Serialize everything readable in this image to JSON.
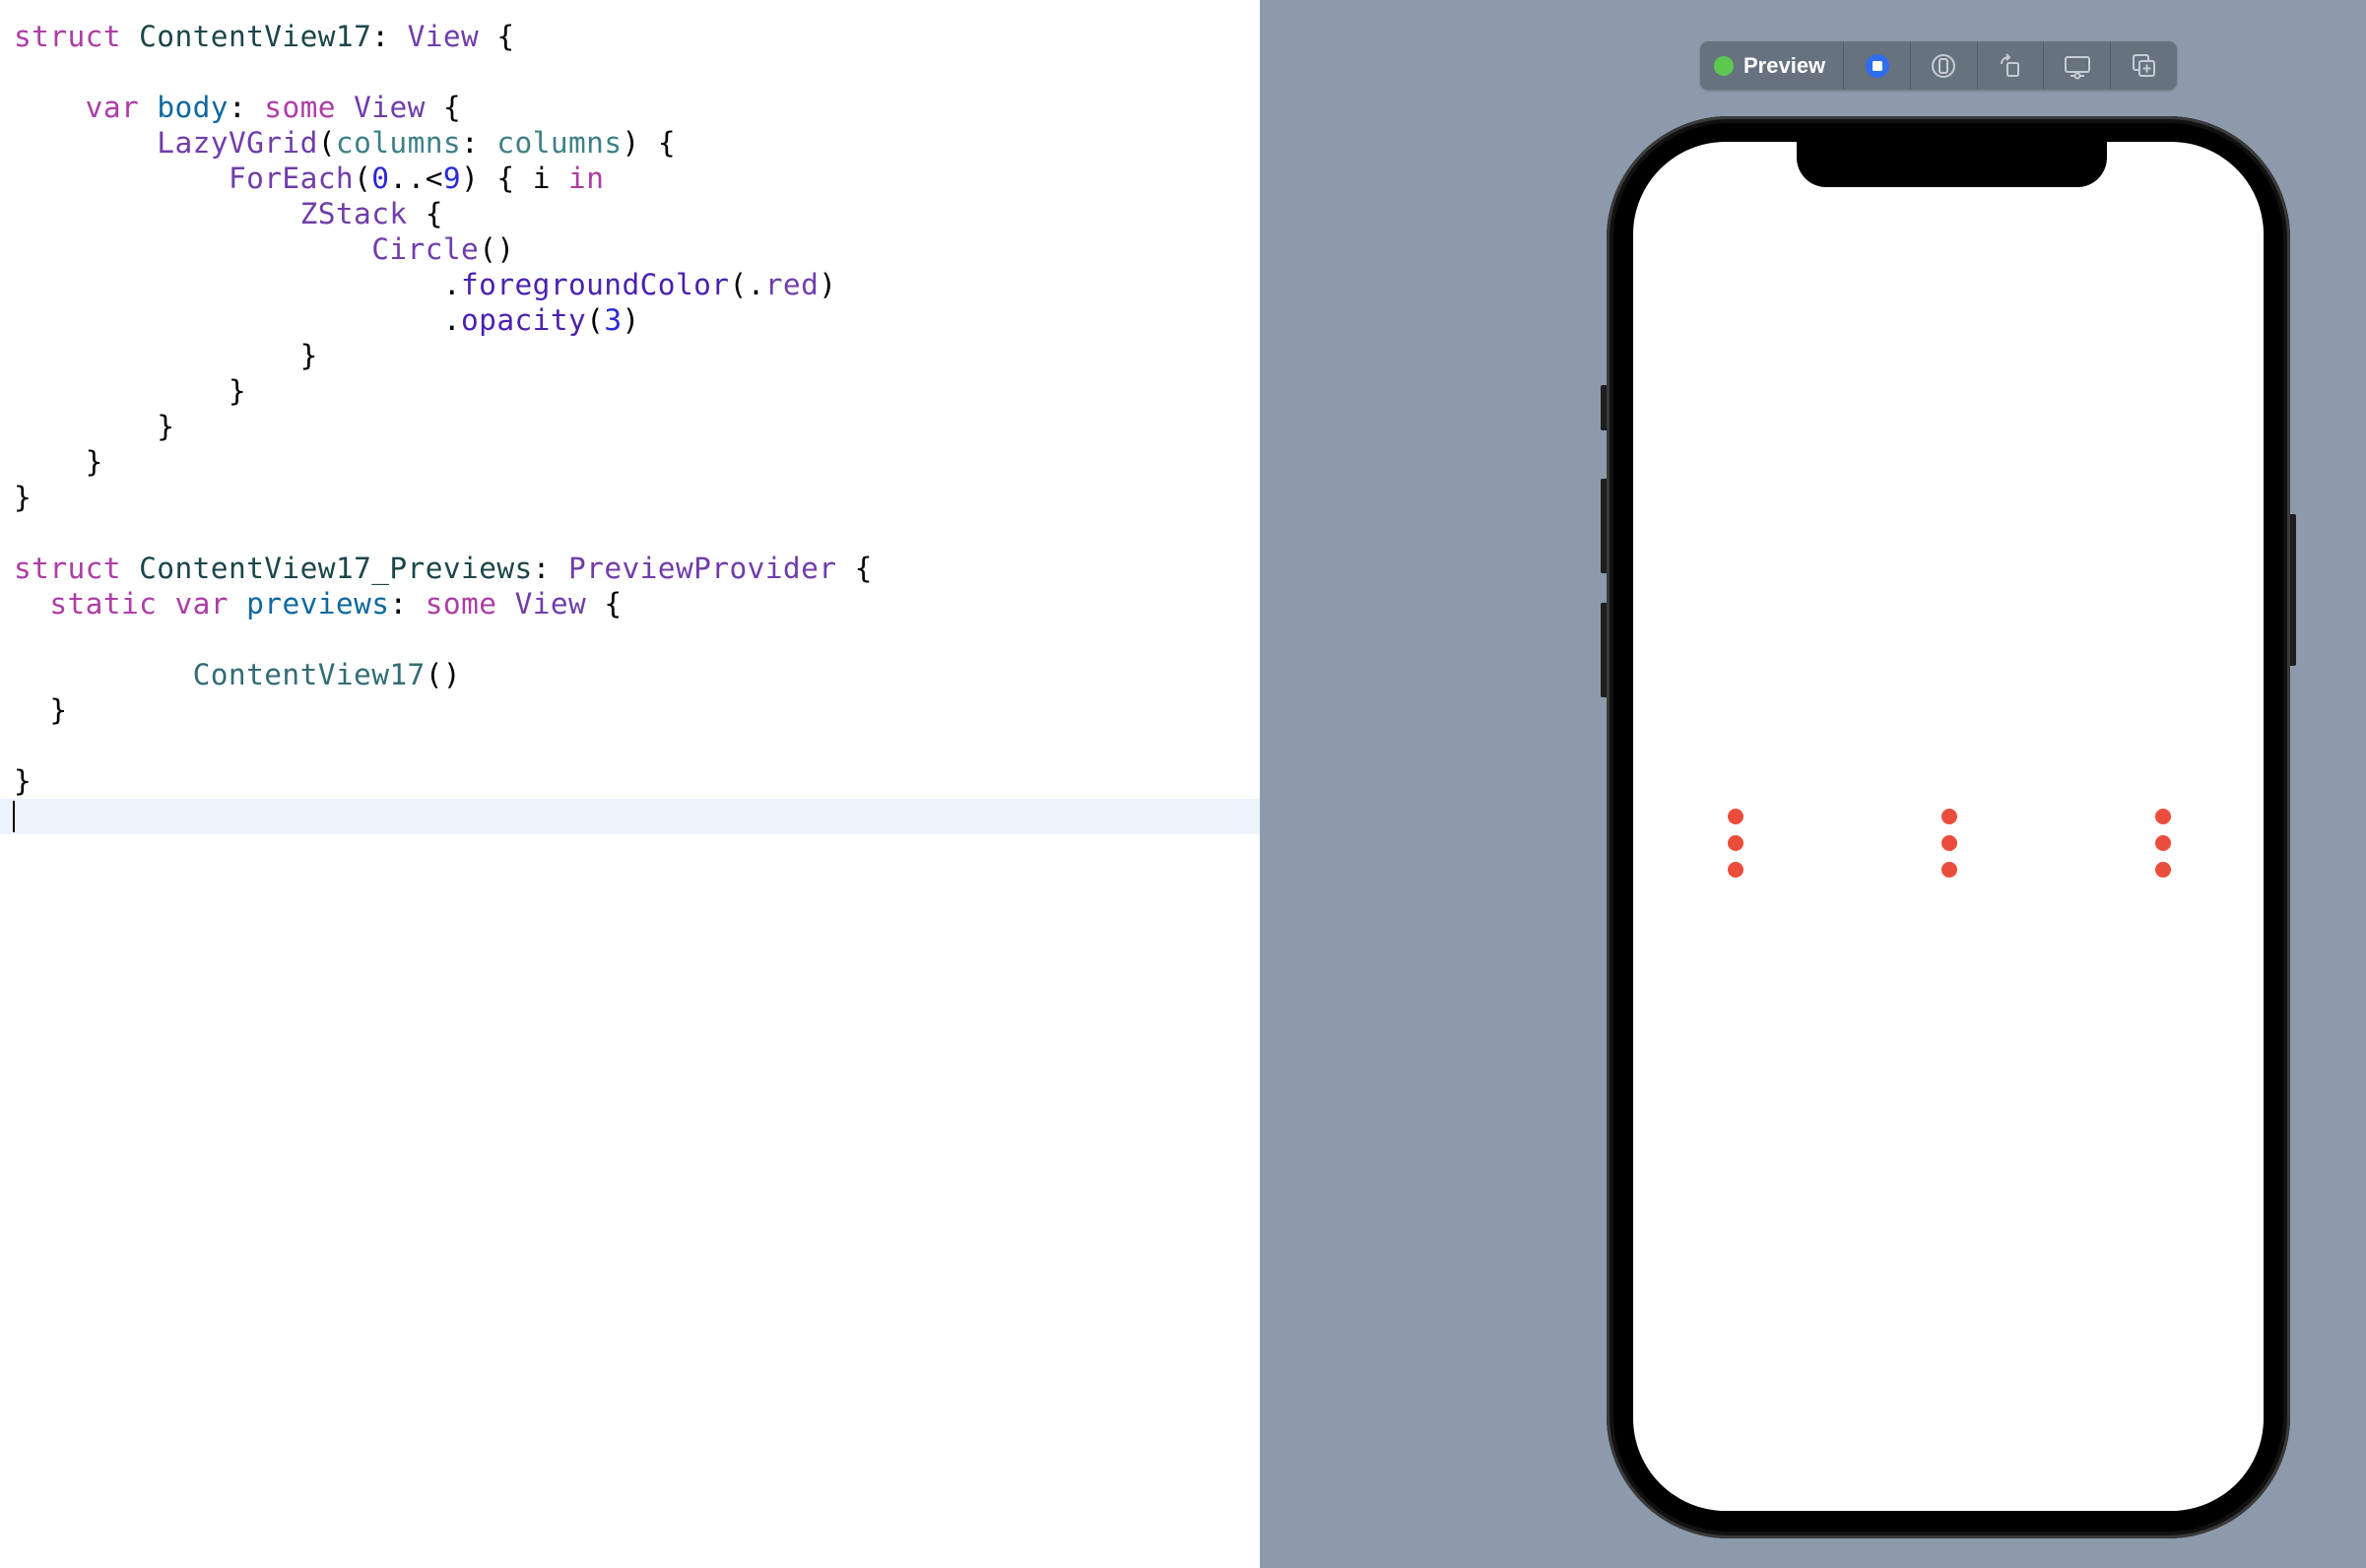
{
  "editor": {
    "lines": [
      [
        {
          "t": "struct",
          "c": "kw"
        },
        {
          "t": " "
        },
        {
          "t": "ContentView17",
          "c": "name"
        },
        {
          "t": ": "
        },
        {
          "t": "View",
          "c": "type"
        },
        {
          "t": " {"
        }
      ],
      [],
      [
        {
          "t": "    "
        },
        {
          "t": "var",
          "c": "kw"
        },
        {
          "t": " "
        },
        {
          "t": "body",
          "c": "decl"
        },
        {
          "t": ": "
        },
        {
          "t": "some",
          "c": "kw"
        },
        {
          "t": " "
        },
        {
          "t": "View",
          "c": "type"
        },
        {
          "t": " {"
        }
      ],
      [
        {
          "t": "        "
        },
        {
          "t": "LazyVGrid",
          "c": "type"
        },
        {
          "t": "("
        },
        {
          "t": "columns",
          "c": "var"
        },
        {
          "t": ": "
        },
        {
          "t": "columns",
          "c": "var"
        },
        {
          "t": ") {"
        }
      ],
      [
        {
          "t": "            "
        },
        {
          "t": "ForEach",
          "c": "type"
        },
        {
          "t": "("
        },
        {
          "t": "0",
          "c": "num"
        },
        {
          "t": "..<"
        },
        {
          "t": "9",
          "c": "num"
        },
        {
          "t": ") { i "
        },
        {
          "t": "in",
          "c": "kw"
        }
      ],
      [
        {
          "t": "                "
        },
        {
          "t": "ZStack",
          "c": "type"
        },
        {
          "t": " {"
        }
      ],
      [
        {
          "t": "                    "
        },
        {
          "t": "Circle",
          "c": "type"
        },
        {
          "t": "()"
        }
      ],
      [
        {
          "t": "                        ."
        },
        {
          "t": "foregroundColor",
          "c": "func"
        },
        {
          "t": "(."
        },
        {
          "t": "red",
          "c": "type"
        },
        {
          "t": ")"
        }
      ],
      [
        {
          "t": "                        ."
        },
        {
          "t": "opacity",
          "c": "func"
        },
        {
          "t": "("
        },
        {
          "t": "3",
          "c": "num"
        },
        {
          "t": ")"
        }
      ],
      [
        {
          "t": "                }"
        }
      ],
      [
        {
          "t": "            }"
        }
      ],
      [
        {
          "t": "        }"
        }
      ],
      [
        {
          "t": "    }"
        }
      ],
      [
        {
          "t": "}"
        }
      ],
      [],
      [
        {
          "t": "struct",
          "c": "kw"
        },
        {
          "t": " "
        },
        {
          "t": "ContentView17_Previews",
          "c": "name"
        },
        {
          "t": ": "
        },
        {
          "t": "PreviewProvider",
          "c": "type"
        },
        {
          "t": " {"
        }
      ],
      [
        {
          "t": "  "
        },
        {
          "t": "static",
          "c": "kw"
        },
        {
          "t": " "
        },
        {
          "t": "var",
          "c": "kw"
        },
        {
          "t": " "
        },
        {
          "t": "previews",
          "c": "decl"
        },
        {
          "t": ": "
        },
        {
          "t": "some",
          "c": "kw"
        },
        {
          "t": " "
        },
        {
          "t": "View",
          "c": "type"
        },
        {
          "t": " {"
        }
      ],
      [],
      [
        {
          "t": "          "
        },
        {
          "t": "ContentView17",
          "c": "memb"
        },
        {
          "t": "()"
        }
      ],
      [
        {
          "t": "  }"
        }
      ],
      [],
      [
        {
          "t": "}"
        }
      ],
      []
    ]
  },
  "preview_toolbar": {
    "live_label": "Preview",
    "buttons": [
      {
        "name": "stop-preview-icon",
        "label": "Stop"
      },
      {
        "name": "live-preview-icon",
        "label": "Live"
      },
      {
        "name": "rotate-device-icon",
        "label": "Rotate"
      },
      {
        "name": "device-settings-icon",
        "label": "Device Settings"
      },
      {
        "name": "duplicate-preview-icon",
        "label": "Duplicate"
      }
    ]
  },
  "colors": {
    "canvas_background": "#8c9aab",
    "dot_color": "#eb4d3d",
    "live_indicator": "#5cc850",
    "keyword": "#ad3da4",
    "type": "#703daa",
    "number": "#272ad8"
  },
  "preview": {
    "columns": 3,
    "circle_count": 9
  }
}
